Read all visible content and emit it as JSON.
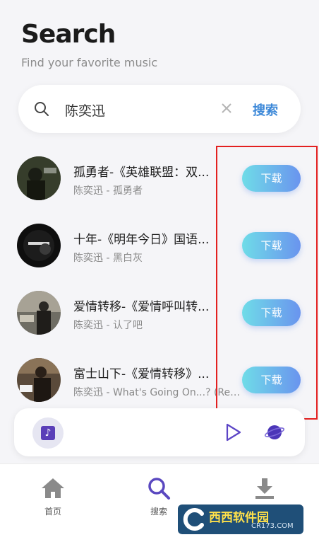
{
  "header": {
    "title": "Search",
    "subtitle": "Find your favorite music"
  },
  "search": {
    "value": "陈奕迅",
    "button_label": "搜索"
  },
  "results": [
    {
      "title": "孤勇者-《英雄联盟：双...",
      "subtitle": "陈奕迅 - 孤勇者",
      "download_label": "下载"
    },
    {
      "title": "十年-《明年今日》国语...",
      "subtitle": "陈奕迅 - 黑白灰",
      "download_label": "下载"
    },
    {
      "title": "爱情转移-《爱情呼叫转...",
      "subtitle": "陈奕迅 - 认了吧",
      "download_label": "下载"
    },
    {
      "title": "富士山下-《爱情转移》...",
      "subtitle": "陈奕迅 - What's Going On...? (Rem...",
      "download_label": "下载"
    }
  ],
  "tabbar": {
    "items": [
      {
        "label": "首页",
        "icon": "home-icon"
      },
      {
        "label": "搜索",
        "icon": "search-icon"
      },
      {
        "label": "",
        "icon": "download-icon"
      }
    ]
  },
  "watermark": {
    "main": "西西软件园",
    "sub": "CR173.COM"
  },
  "colors": {
    "accent": "#3c88d8",
    "download_gradient_start": "#6fdce8",
    "download_gradient_end": "#6a94ee",
    "highlight": "#e32020"
  }
}
